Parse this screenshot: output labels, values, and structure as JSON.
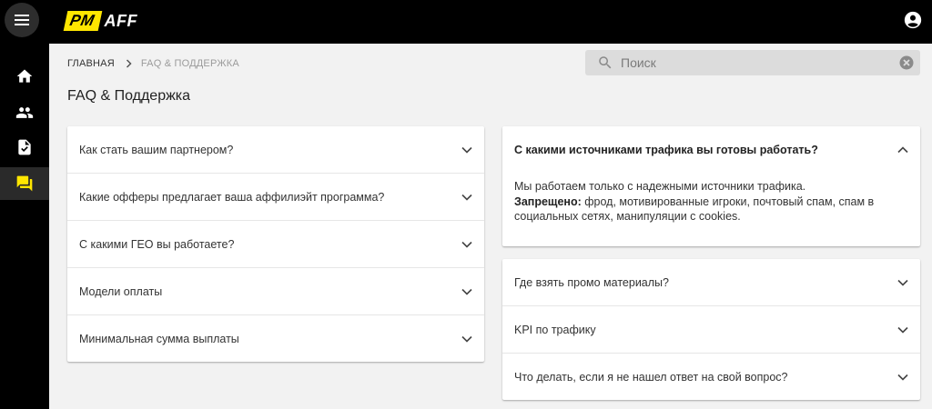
{
  "app": {
    "logo_pm": "PM",
    "logo_aff": "AFF",
    "brand_color": "#ffe600"
  },
  "nav": {
    "items": [
      {
        "icon": "home-icon"
      },
      {
        "icon": "people-icon"
      },
      {
        "icon": "document-icon"
      },
      {
        "icon": "chat-icon",
        "active": true
      }
    ]
  },
  "breadcrumb": {
    "home": "ГЛАВНАЯ",
    "current": "FAQ & ПОДДЕРЖКА"
  },
  "search": {
    "placeholder": "Поиск",
    "value": ""
  },
  "page": {
    "title": "FAQ & Поддержка"
  },
  "faq_left": [
    {
      "question": "Как стать вашим партнером?"
    },
    {
      "question": "Какие офферы предлагает ваша аффилиэйт программа?"
    },
    {
      "question": "С какими ГЕО вы работаете?"
    },
    {
      "question": "Модели оплаты"
    },
    {
      "question": "Минимальная сумма выплаты"
    }
  ],
  "faq_expanded": {
    "question": "С какими источниками трафика вы готовы работать?",
    "answer_line1": "Мы работаем только с надежными источники трафика.",
    "answer_bold": "Запрещено:",
    "answer_rest": " фрод, мотивированные игроки, почтовый спам, спам в социальных сетях, манипуляции с cookies."
  },
  "faq_right": [
    {
      "question": "Где взять промо материалы?"
    },
    {
      "question": "KPI по трафику"
    },
    {
      "question": "Что делать, если я не нашел ответ на свой вопрос?"
    }
  ]
}
